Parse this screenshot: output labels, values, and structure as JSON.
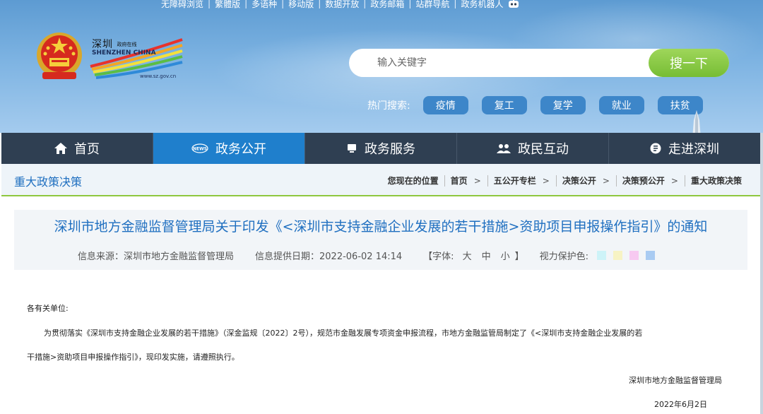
{
  "topbar": {
    "links": [
      "无障碍浏览",
      "繁體版",
      "多语种",
      "移动版",
      "数据开放",
      "政务邮箱",
      "站群导航",
      "政务机器人"
    ]
  },
  "brand": {
    "name_cn": "深圳",
    "name_cn_small": "政府在线",
    "name_en": "SHENZHEN CHINA",
    "url": "www.sz.gov.cn"
  },
  "search": {
    "placeholder": "输入关键字",
    "button_label": "搜一下",
    "hot_label": "热门搜索:",
    "hot_tags": [
      "疫情",
      "复工",
      "复学",
      "就业",
      "扶贫"
    ]
  },
  "nav": {
    "items": [
      {
        "label": "首页",
        "icon": "home-icon"
      },
      {
        "label": "政务公开",
        "icon": "news-icon"
      },
      {
        "label": "政务服务",
        "icon": "monitor-icon"
      },
      {
        "label": "政民互动",
        "icon": "people-icon"
      },
      {
        "label": "走进深圳",
        "icon": "info-icon"
      }
    ],
    "active_index": 1
  },
  "section": {
    "title": "重大政策决策",
    "location_label": "您现在的位置",
    "breadcrumb": [
      "首页",
      "五公开专栏",
      "决策公开",
      "决策预公开",
      "重大政策决策"
    ]
  },
  "article": {
    "title": "深圳市地方金融监督管理局关于印发《<深圳市支持金融企业发展的若干措施>资助项目申报操作指引》的通知",
    "source": "信息来源：深圳市地方金融监督管理局",
    "date": "信息提供日期：2022-06-02 14:14",
    "font_open": "【字体:",
    "font_sizes": [
      "大",
      "中",
      "小"
    ],
    "font_close": "】",
    "eye_label": "视力保护色:",
    "eye_colors": [
      "#cdf3f8",
      "#f7f3c4",
      "#f7c9f1",
      "#a9cbf2"
    ],
    "salutation": "各有关单位:",
    "para1": "为贯彻落实《深圳市支持金融企业发展的若干措施》（深金监规〔2022〕2号），规范市金融发展专项资金申报流程，市地方金融监管局制定了《<深圳市支持金融企业发展的若",
    "para2": "干措施>资助项目申报操作指引》，现印发实施，请遵照执行。",
    "signer": "深圳市地方金融监督管理局",
    "sign_date": "2022年6月2日"
  },
  "colors": {
    "nav_bg": "#2f3f52",
    "nav_active": "#1f7fcc",
    "accent_green": "#8ec73f",
    "title_blue": "#1f6fc0"
  }
}
